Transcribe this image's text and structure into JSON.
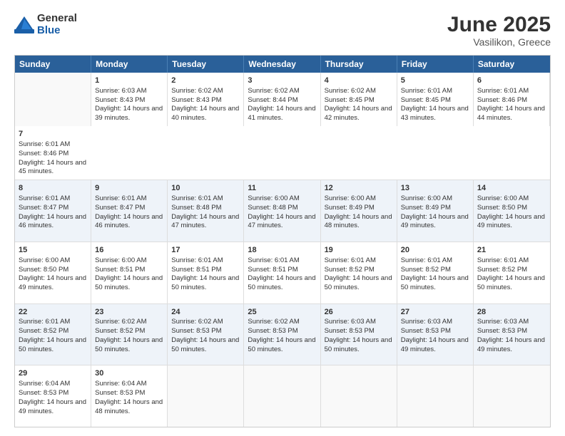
{
  "logo": {
    "general": "General",
    "blue": "Blue"
  },
  "title": "June 2025",
  "subtitle": "Vasilikon, Greece",
  "days": [
    "Sunday",
    "Monday",
    "Tuesday",
    "Wednesday",
    "Thursday",
    "Friday",
    "Saturday"
  ],
  "rows": [
    [
      {
        "num": "",
        "empty": true
      },
      {
        "num": "1",
        "rise": "6:03 AM",
        "set": "8:43 PM",
        "daylight": "14 hours and 39 minutes."
      },
      {
        "num": "2",
        "rise": "6:02 AM",
        "set": "8:43 PM",
        "daylight": "14 hours and 40 minutes."
      },
      {
        "num": "3",
        "rise": "6:02 AM",
        "set": "8:44 PM",
        "daylight": "14 hours and 41 minutes."
      },
      {
        "num": "4",
        "rise": "6:02 AM",
        "set": "8:45 PM",
        "daylight": "14 hours and 42 minutes."
      },
      {
        "num": "5",
        "rise": "6:01 AM",
        "set": "8:45 PM",
        "daylight": "14 hours and 43 minutes."
      },
      {
        "num": "6",
        "rise": "6:01 AM",
        "set": "8:46 PM",
        "daylight": "14 hours and 44 minutes."
      },
      {
        "num": "7",
        "rise": "6:01 AM",
        "set": "8:46 PM",
        "daylight": "14 hours and 45 minutes."
      }
    ],
    [
      {
        "num": "8",
        "rise": "6:01 AM",
        "set": "8:47 PM",
        "daylight": "14 hours and 46 minutes."
      },
      {
        "num": "9",
        "rise": "6:01 AM",
        "set": "8:47 PM",
        "daylight": "14 hours and 46 minutes."
      },
      {
        "num": "10",
        "rise": "6:01 AM",
        "set": "8:48 PM",
        "daylight": "14 hours and 47 minutes."
      },
      {
        "num": "11",
        "rise": "6:00 AM",
        "set": "8:48 PM",
        "daylight": "14 hours and 47 minutes."
      },
      {
        "num": "12",
        "rise": "6:00 AM",
        "set": "8:49 PM",
        "daylight": "14 hours and 48 minutes."
      },
      {
        "num": "13",
        "rise": "6:00 AM",
        "set": "8:49 PM",
        "daylight": "14 hours and 49 minutes."
      },
      {
        "num": "14",
        "rise": "6:00 AM",
        "set": "8:50 PM",
        "daylight": "14 hours and 49 minutes."
      }
    ],
    [
      {
        "num": "15",
        "rise": "6:00 AM",
        "set": "8:50 PM",
        "daylight": "14 hours and 49 minutes."
      },
      {
        "num": "16",
        "rise": "6:00 AM",
        "set": "8:51 PM",
        "daylight": "14 hours and 50 minutes."
      },
      {
        "num": "17",
        "rise": "6:01 AM",
        "set": "8:51 PM",
        "daylight": "14 hours and 50 minutes."
      },
      {
        "num": "18",
        "rise": "6:01 AM",
        "set": "8:51 PM",
        "daylight": "14 hours and 50 minutes."
      },
      {
        "num": "19",
        "rise": "6:01 AM",
        "set": "8:52 PM",
        "daylight": "14 hours and 50 minutes."
      },
      {
        "num": "20",
        "rise": "6:01 AM",
        "set": "8:52 PM",
        "daylight": "14 hours and 50 minutes."
      },
      {
        "num": "21",
        "rise": "6:01 AM",
        "set": "8:52 PM",
        "daylight": "14 hours and 50 minutes."
      }
    ],
    [
      {
        "num": "22",
        "rise": "6:01 AM",
        "set": "8:52 PM",
        "daylight": "14 hours and 50 minutes."
      },
      {
        "num": "23",
        "rise": "6:02 AM",
        "set": "8:52 PM",
        "daylight": "14 hours and 50 minutes."
      },
      {
        "num": "24",
        "rise": "6:02 AM",
        "set": "8:53 PM",
        "daylight": "14 hours and 50 minutes."
      },
      {
        "num": "25",
        "rise": "6:02 AM",
        "set": "8:53 PM",
        "daylight": "14 hours and 50 minutes."
      },
      {
        "num": "26",
        "rise": "6:03 AM",
        "set": "8:53 PM",
        "daylight": "14 hours and 50 minutes."
      },
      {
        "num": "27",
        "rise": "6:03 AM",
        "set": "8:53 PM",
        "daylight": "14 hours and 49 minutes."
      },
      {
        "num": "28",
        "rise": "6:03 AM",
        "set": "8:53 PM",
        "daylight": "14 hours and 49 minutes."
      }
    ],
    [
      {
        "num": "29",
        "rise": "6:04 AM",
        "set": "8:53 PM",
        "daylight": "14 hours and 49 minutes."
      },
      {
        "num": "30",
        "rise": "6:04 AM",
        "set": "8:53 PM",
        "daylight": "14 hours and 48 minutes."
      },
      {
        "num": "",
        "empty": true
      },
      {
        "num": "",
        "empty": true
      },
      {
        "num": "",
        "empty": true
      },
      {
        "num": "",
        "empty": true
      },
      {
        "num": "",
        "empty": true
      }
    ]
  ]
}
